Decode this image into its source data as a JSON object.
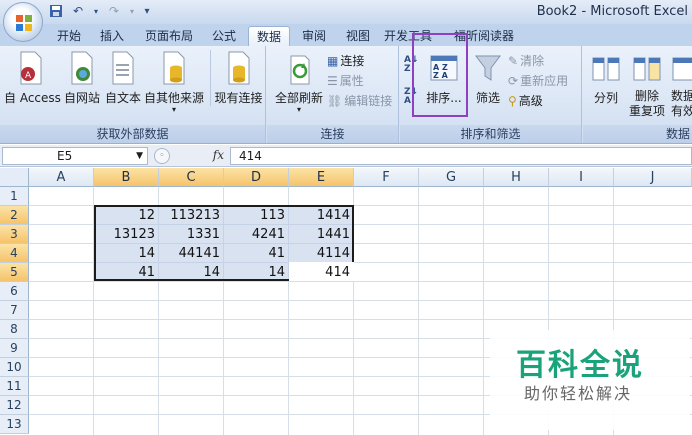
{
  "window": {
    "title": "Book2 - Microsoft Excel"
  },
  "quick_access": {
    "save": "save-icon",
    "undo": "undo-icon",
    "redo": "redo-icon",
    "more": "▾"
  },
  "tabs": [
    "开始",
    "插入",
    "页面布局",
    "公式",
    "数据",
    "审阅",
    "视图",
    "开发工具",
    "福昕阅读器"
  ],
  "active_tab": "数据",
  "ribbon": {
    "get_external": {
      "label": "获取外部数据",
      "access": "自 Access",
      "web": "自网站",
      "text": "自文本",
      "other": "自其他来源",
      "existing": "现有连接"
    },
    "connections": {
      "label": "连接",
      "refresh_all": "全部刷新",
      "connections": "连接",
      "properties": "属性",
      "edit_links": "编辑链接"
    },
    "sort_filter": {
      "label": "排序和筛选",
      "sort": "排序...",
      "filter": "筛选",
      "clear": "清除",
      "reapply": "重新应用",
      "advanced": "高级"
    },
    "data_tools": {
      "label": "数据",
      "split": "分列",
      "remove_dup_line1": "删除",
      "remove_dup_line2": "重复项",
      "validation_line1": "数据",
      "validation_line2": "有效"
    }
  },
  "formula_bar": {
    "name_box": "E5",
    "fx": "fx",
    "value": "414"
  },
  "columns": [
    "A",
    "B",
    "C",
    "D",
    "E",
    "F",
    "G",
    "H",
    "I",
    "J"
  ],
  "rows": [
    "1",
    "2",
    "3",
    "4",
    "5",
    "6",
    "7",
    "8",
    "9",
    "10",
    "11",
    "12",
    "13"
  ],
  "cells": [
    [
      "12",
      "113213",
      "113",
      "1414"
    ],
    [
      "13123",
      "1331",
      "4241",
      "1441"
    ],
    [
      "14",
      "44141",
      "41",
      "4114"
    ],
    [
      "41",
      "14",
      "14",
      "414"
    ]
  ],
  "watermark": {
    "main": "百科全说",
    "sub": "助你轻松解决"
  }
}
